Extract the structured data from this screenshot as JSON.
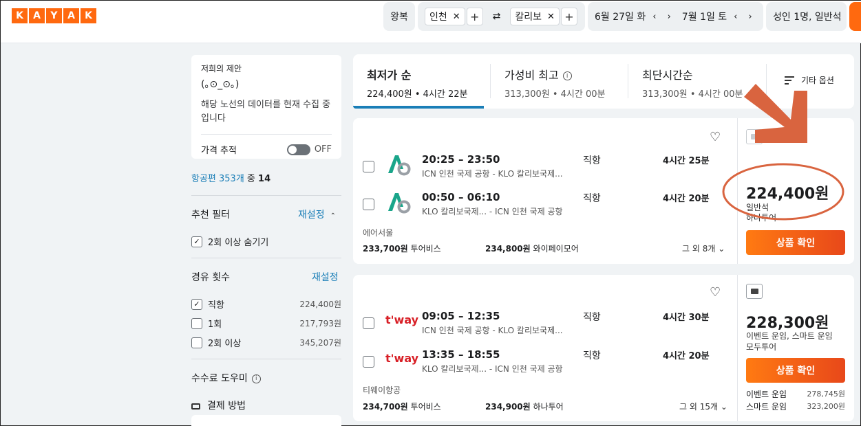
{
  "brand": {
    "logo_letters": [
      "K",
      "A",
      "Y",
      "A",
      "K"
    ],
    "accent": "#ff690f",
    "link_color": "#1a7eb7"
  },
  "search": {
    "trip_type": "왕복",
    "origin": "인천",
    "destination": "칼리보",
    "swap_icon": "⇄",
    "depart_date": "6월 27일 화",
    "return_date": "7월 1일 토",
    "date_nav": "‹ ›",
    "passengers": "성인 1명, 일반석"
  },
  "offer": {
    "title": "저희의 제안",
    "face": "(｡⊙_⊙｡)",
    "text": "해당 노선의 데이터를 현재 수집 중입니다",
    "tracker_label": "가격 추적",
    "tracker_state": "OFF"
  },
  "results_count": {
    "link": "항공편 353개",
    "middle": " 중 ",
    "shown": "14"
  },
  "filters": {
    "recommended": {
      "title": "추천 필터",
      "reset": "재설정",
      "hide_multi": "2회 이상 숨기기"
    },
    "stops": {
      "title": "경유 횟수",
      "reset": "재설정",
      "options": [
        {
          "label": "직항",
          "price": "224,400원",
          "checked": true
        },
        {
          "label": "1회",
          "price": "217,793원",
          "checked": false
        },
        {
          "label": "2회 이상",
          "price": "345,207원",
          "checked": false
        }
      ]
    },
    "fees": {
      "title": "수수료 도우미",
      "payment": "결제 방법"
    }
  },
  "sort_tabs": [
    {
      "label": "최저가 순",
      "sub": "224,400원 • 4시간 22분",
      "active": true
    },
    {
      "label": "가성비 최고",
      "sub": "313,300원 • 4시간 00분",
      "active": false,
      "info": "i"
    },
    {
      "label": "최단시간순",
      "sub": "313,300원 • 4시간 00분",
      "active": false
    }
  ],
  "more_options": "기타 옵션",
  "results": [
    {
      "airline": "에어서울",
      "logo": "air-seoul-logo",
      "legs": [
        {
          "times": "20:25 – 23:50",
          "airports": "ICN 인천 국제 공항 - KLO 칼리보국제...",
          "stops": "직항",
          "duration": "4시간 25분"
        },
        {
          "times": "00:50 – 06:10",
          "airports": "KLO 칼리보국제...   - ICN 인천 국제 공항",
          "stops": "직항",
          "duration": "4시간 20분"
        }
      ],
      "providers": [
        {
          "price": "233,700원",
          "name": "투어비스"
        },
        {
          "price": "234,800원",
          "name": "와이페이모어"
        }
      ],
      "others": "그 외 8개",
      "price": "224,400원",
      "cabin": "일반석",
      "provider_under_price": "하나투어",
      "cta": "상품 확인"
    },
    {
      "airline": "티웨이항공",
      "logo": "tway-logo",
      "logo_text": "t'way",
      "legs": [
        {
          "times": "09:05 – 12:35",
          "airports": "ICN 인천 국제 공항 - KLO 칼리보국제...",
          "stops": "직항",
          "duration": "4시간 30분"
        },
        {
          "times": "13:35 – 18:55",
          "airports": "KLO 칼리보국제...   - ICN 인천 국제 공항",
          "stops": "직항",
          "duration": "4시간 20분"
        }
      ],
      "providers": [
        {
          "price": "234,700원",
          "name": "투어비스"
        },
        {
          "price": "234,900원",
          "name": "하나투어"
        }
      ],
      "others": "그 외 15개",
      "price": "228,300원",
      "cabin": "이벤트 운임, 스마트 운임",
      "provider_under_price": "모두투어",
      "cta": "상품 확인",
      "fares": [
        {
          "label": "이벤트 운임",
          "price": "278,745원"
        },
        {
          "label": "스마트 운임",
          "price": "323,200원"
        }
      ]
    }
  ],
  "annotation_color": "#d9643f"
}
